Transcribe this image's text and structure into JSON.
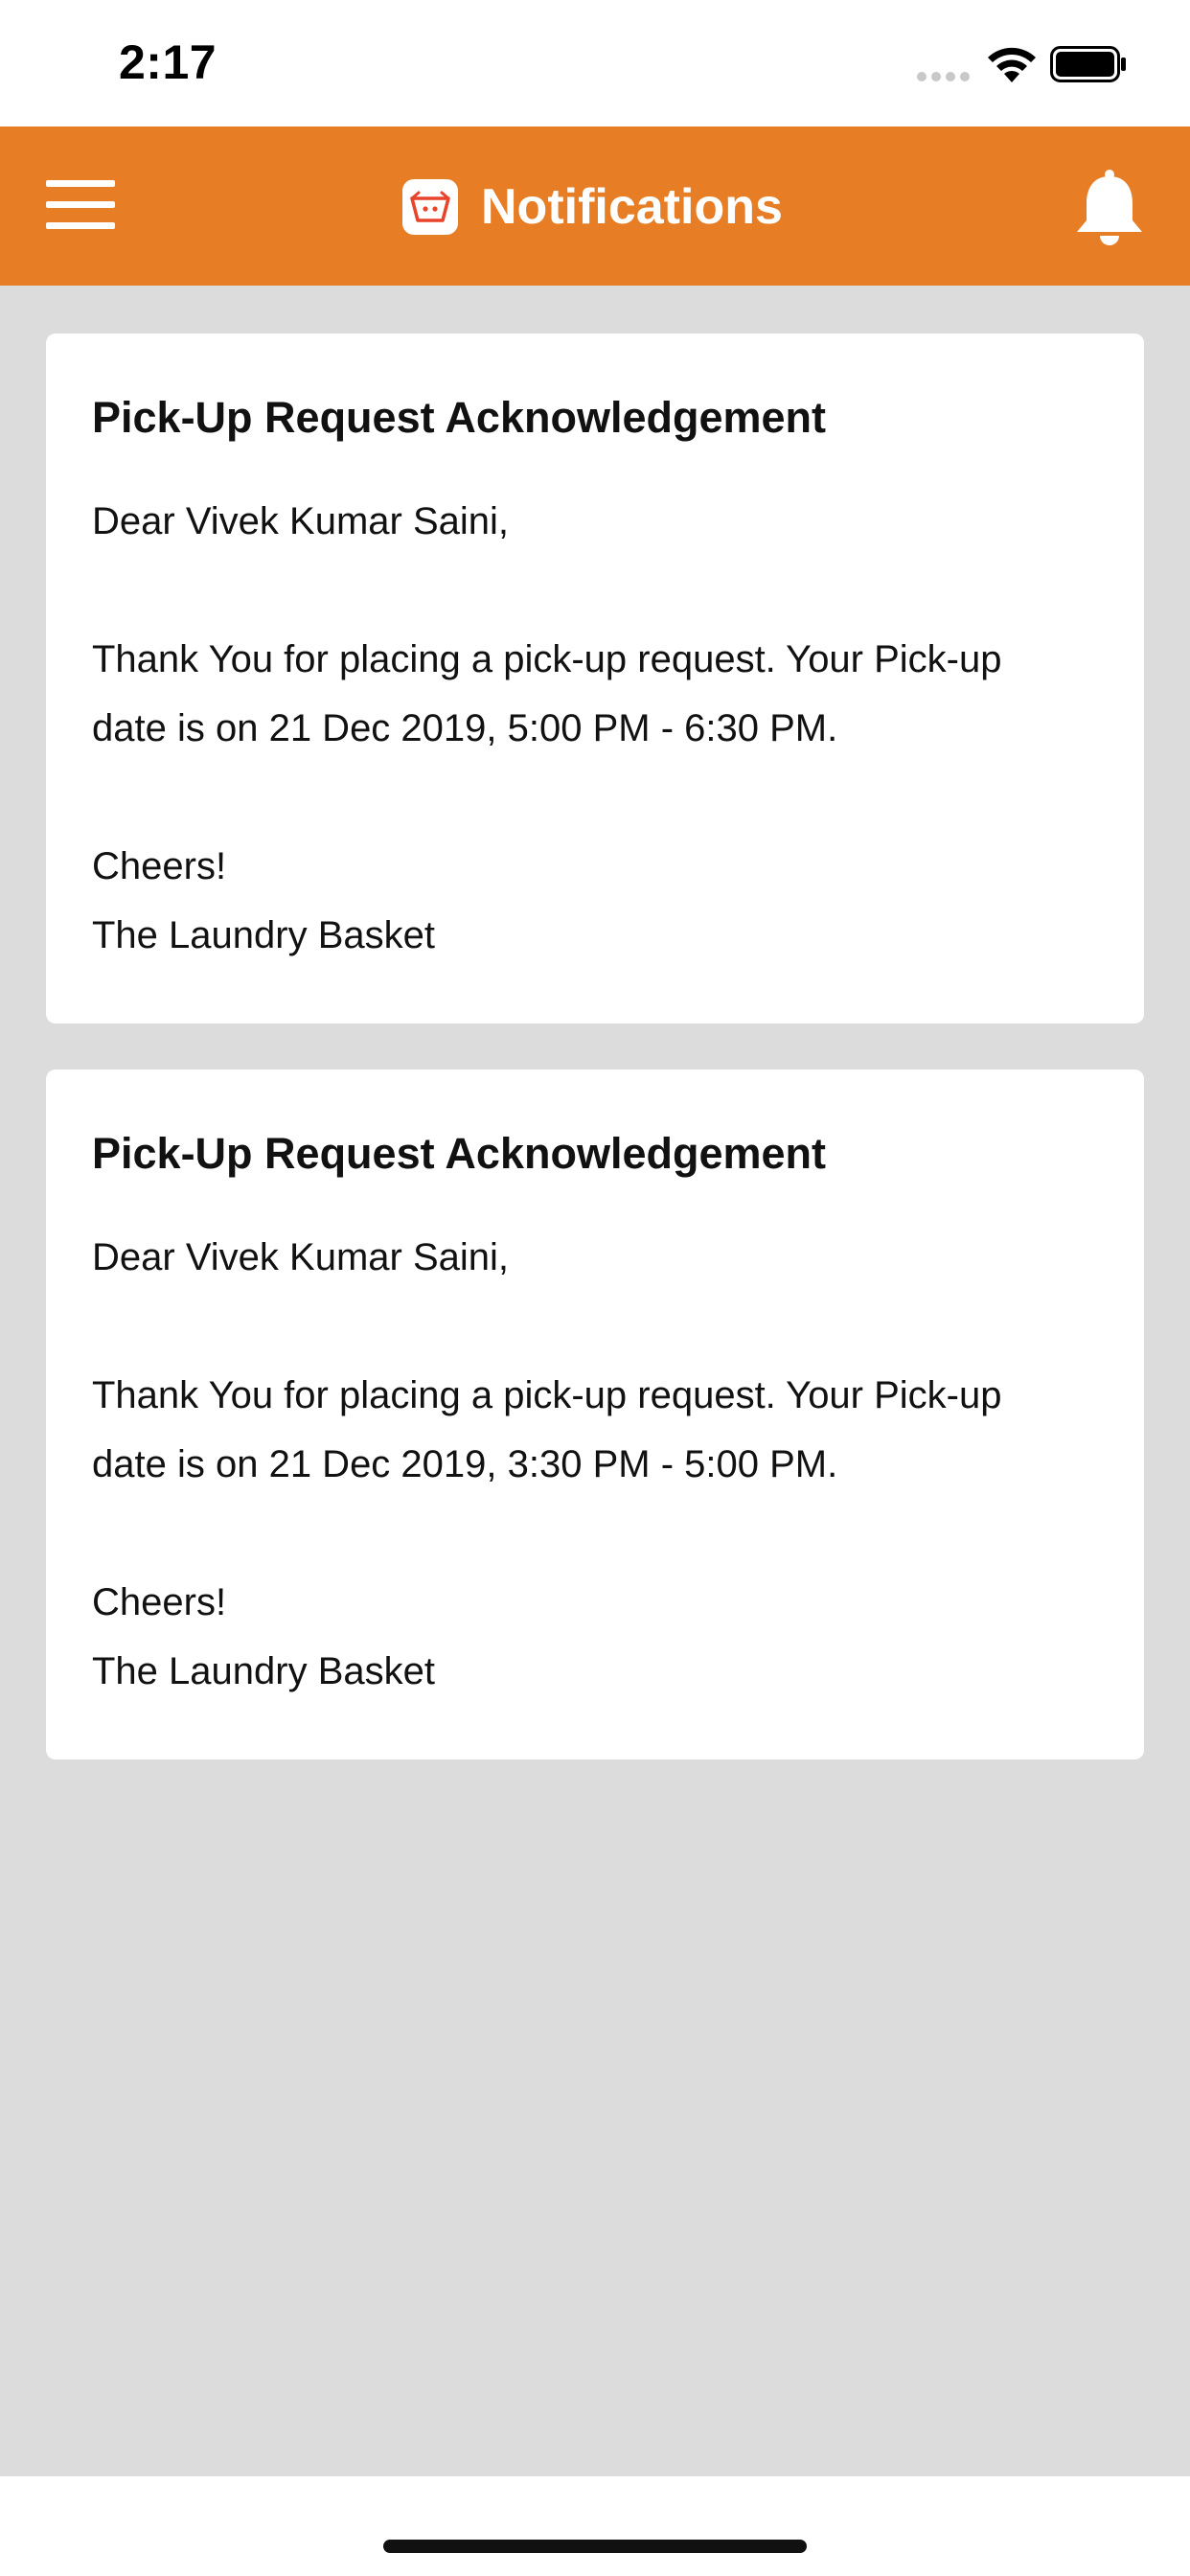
{
  "status_bar": {
    "time": "2:17"
  },
  "header": {
    "title": "Notifications",
    "logo_icon": "laundry-basket-icon",
    "menu_icon": "hamburger-menu-icon",
    "bell_icon": "bell-icon",
    "accent_color": "#E77E26"
  },
  "notifications": [
    {
      "title": "Pick-Up Request Acknowledgement",
      "greeting": "Dear Vivek Kumar Saini,",
      "body_line1": "Thank You for placing a pick-up request. Your Pick-up",
      "body_line2": "date is on 21 Dec 2019, 5:00 PM - 6:30 PM.",
      "signoff": "Cheers!",
      "signature": "The Laundry Basket"
    },
    {
      "title": "Pick-Up Request Acknowledgement",
      "greeting": "Dear Vivek Kumar Saini,",
      "body_line1": "Thank You for placing a pick-up request. Your Pick-up",
      "body_line2": "date is on 21 Dec 2019, 3:30 PM - 5:00 PM.",
      "signoff": "Cheers!",
      "signature": "The Laundry Basket"
    }
  ]
}
